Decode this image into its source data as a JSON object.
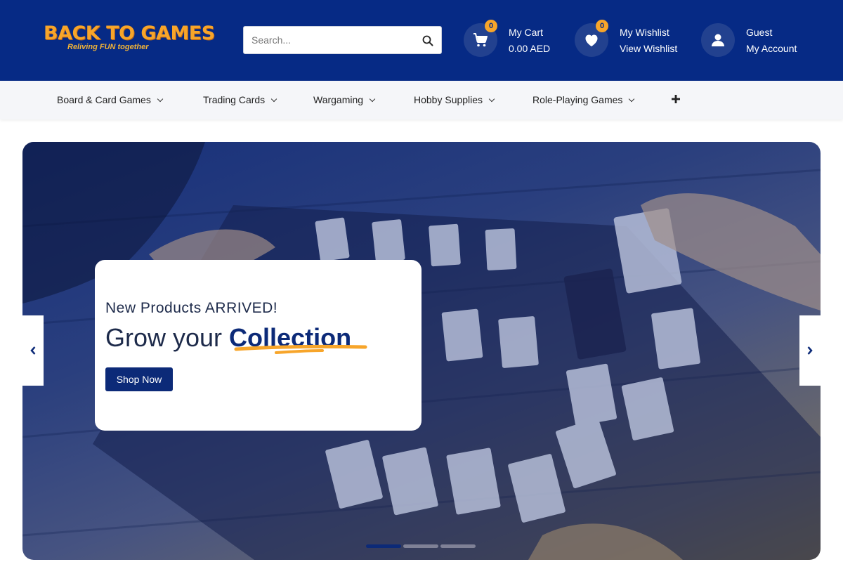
{
  "header": {
    "logo": {
      "main": "BACK TO GAMES",
      "tagline": "Reliving FUN together"
    },
    "search": {
      "placeholder": "Search..."
    },
    "cart": {
      "badge": "0",
      "label": "My Cart",
      "amount": "0.00 AED"
    },
    "wishlist": {
      "badge": "0",
      "label": "My Wishlist",
      "link": "View Wishlist"
    },
    "account": {
      "label": "Guest",
      "link": "My Account"
    }
  },
  "nav": {
    "items": [
      {
        "label": "Board & Card Games"
      },
      {
        "label": "Trading Cards"
      },
      {
        "label": "Wargaming"
      },
      {
        "label": "Hobby Supplies"
      },
      {
        "label": "Role-Playing Games"
      }
    ],
    "more_icon": "plus-icon"
  },
  "hero": {
    "subtitle": "New Products ARRIVED!",
    "title_prefix": "Grow your ",
    "title_highlight": "Collection",
    "cta": "Shop Now",
    "slide_count": 3,
    "active_slide": 0
  },
  "colors": {
    "brand_blue": "#062a85",
    "accent_orange": "#f7a52a",
    "dark_blue": "#0c2a78"
  }
}
